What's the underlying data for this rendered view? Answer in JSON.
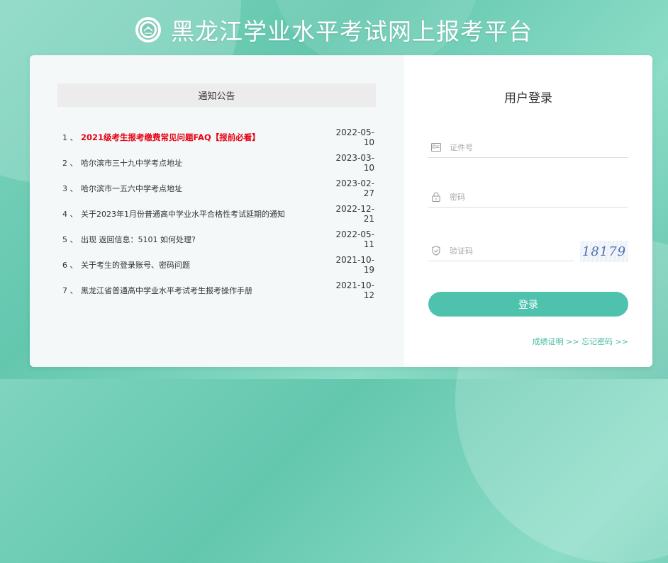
{
  "header": {
    "title": "黑龙江学业水平考试网上报考平台",
    "logo_icon": "emblem-icon"
  },
  "notice": {
    "header": "通知公告",
    "items": [
      {
        "num": "1 、",
        "title": "2021级考生报考缴费常见问题FAQ【报前必看】",
        "date": "2022-05-10",
        "highlight": true
      },
      {
        "num": "2 、",
        "title": "哈尔滨市三十九中学考点地址",
        "date": "2023-03-10"
      },
      {
        "num": "3 、",
        "title": "哈尔滨市一五六中学考点地址",
        "date": "2023-02-27"
      },
      {
        "num": "4 、",
        "title": "关于2023年1月份普通高中学业水平合格性考试延期的通知",
        "date": "2022-12-21"
      },
      {
        "num": "5 、",
        "title": "出现 返回信息：5101 如何处理?",
        "date": "2022-05-11"
      },
      {
        "num": "6 、",
        "title": "关于考生的登录账号、密码问题",
        "date": "2021-10-19"
      },
      {
        "num": "7 、",
        "title": "黑龙江省普通高中学业水平考试考生报考操作手册",
        "date": "2021-10-12"
      }
    ]
  },
  "login": {
    "title": "用户登录",
    "id_placeholder": "证件号",
    "password_placeholder": "密码",
    "captcha_placeholder": "验证码",
    "captcha_value": "18179",
    "button": "登录",
    "score_link": "成绩证明 >>",
    "forgot_link": "忘记密码 >>"
  },
  "colors": {
    "accent": "#4fc2ad",
    "highlight": "#e60012",
    "link": "#45b9a2"
  }
}
